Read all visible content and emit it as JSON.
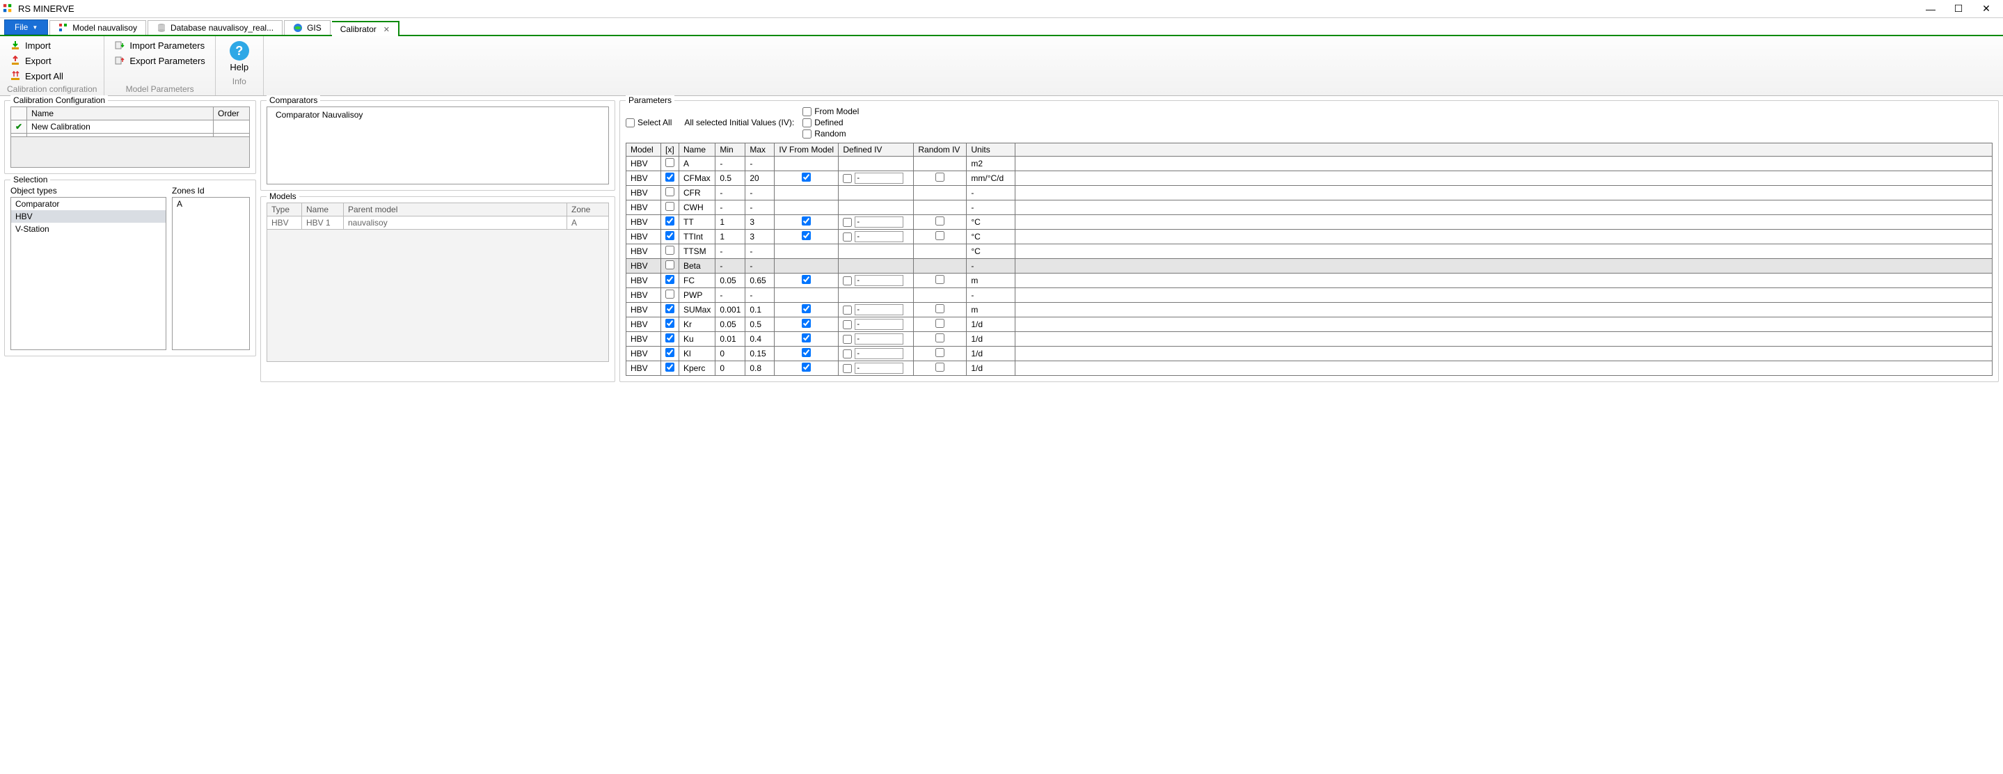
{
  "window": {
    "title": "RS MINERVE"
  },
  "tabs": {
    "file": "File",
    "items": [
      {
        "label": "Model nauvalisoy"
      },
      {
        "label": "Database nauvalisoy_real..."
      },
      {
        "label": "GIS"
      },
      {
        "label": "Calibrator"
      }
    ]
  },
  "ribbon": {
    "g1": {
      "import": "Import",
      "export": "Export",
      "export_all": "Export All",
      "label": "Calibration configuration"
    },
    "g2": {
      "import_params": "Import Parameters",
      "export_params": "Export Parameters",
      "label": "Model Parameters"
    },
    "g3": {
      "help": "Help",
      "label": "Info"
    }
  },
  "cal_conf": {
    "legend": "Calibration Configuration",
    "headers": {
      "name": "Name",
      "order": "Order"
    },
    "rows": [
      {
        "name": "New Calibration",
        "order": ""
      }
    ]
  },
  "selection": {
    "legend": "Selection",
    "obj_types_label": "Object types",
    "zones_label": "Zones Id",
    "obj_types": [
      "Comparator",
      "HBV",
      "V-Station"
    ],
    "zones": [
      "A"
    ]
  },
  "comparators": {
    "legend": "Comparators",
    "items": [
      "Comparator Nauvalisoy"
    ]
  },
  "models": {
    "legend": "Models",
    "headers": {
      "type": "Type",
      "name": "Name",
      "parent": "Parent model",
      "zone": "Zone"
    },
    "rows": [
      {
        "type": "HBV",
        "name": "HBV 1",
        "parent": "nauvalisoy",
        "zone": "A"
      }
    ]
  },
  "params": {
    "legend": "Parameters",
    "select_all": "Select All",
    "iv_label": "All selected Initial Values (IV):",
    "iv_opts": {
      "from_model": "From Model",
      "defined": "Defined",
      "random": "Random"
    },
    "headers": {
      "model": "Model",
      "x": "[x]",
      "name": "Name",
      "min": "Min",
      "max": "Max",
      "ivm": "IV From Model",
      "div": "Defined IV",
      "riv": "Random IV",
      "units": "Units"
    },
    "rows": [
      {
        "model": "HBV",
        "x": false,
        "name": "A",
        "min": "-",
        "max": "-",
        "ivm": null,
        "div": null,
        "riv": null,
        "units": "m2"
      },
      {
        "model": "HBV",
        "x": true,
        "name": "CFMax",
        "min": "0.5",
        "max": "20",
        "ivm": true,
        "div": {
          "checked": false,
          "value": "-"
        },
        "riv": false,
        "units": "mm/°C/d"
      },
      {
        "model": "HBV",
        "x": false,
        "name": "CFR",
        "min": "-",
        "max": "-",
        "ivm": null,
        "div": null,
        "riv": null,
        "units": "-"
      },
      {
        "model": "HBV",
        "x": false,
        "name": "CWH",
        "min": "-",
        "max": "-",
        "ivm": null,
        "div": null,
        "riv": null,
        "units": "-"
      },
      {
        "model": "HBV",
        "x": true,
        "name": "TT",
        "min": "1",
        "max": "3",
        "ivm": true,
        "div": {
          "checked": false,
          "value": "-"
        },
        "riv": false,
        "units": "°C"
      },
      {
        "model": "HBV",
        "x": true,
        "name": "TTInt",
        "min": "1",
        "max": "3",
        "ivm": true,
        "div": {
          "checked": false,
          "value": "-"
        },
        "riv": false,
        "units": "°C"
      },
      {
        "model": "HBV",
        "x": false,
        "name": "TTSM",
        "min": "-",
        "max": "-",
        "ivm": null,
        "div": null,
        "riv": null,
        "units": "°C"
      },
      {
        "model": "HBV",
        "x": false,
        "name": "Beta",
        "min": "-",
        "max": "-",
        "ivm": null,
        "div": null,
        "riv": null,
        "units": "-",
        "hi": true
      },
      {
        "model": "HBV",
        "x": true,
        "name": "FC",
        "min": "0.05",
        "max": "0.65",
        "ivm": true,
        "div": {
          "checked": false,
          "value": "-"
        },
        "riv": false,
        "units": "m"
      },
      {
        "model": "HBV",
        "x": false,
        "name": "PWP",
        "min": "-",
        "max": "-",
        "ivm": null,
        "div": null,
        "riv": null,
        "units": "-"
      },
      {
        "model": "HBV",
        "x": true,
        "name": "SUMax",
        "min": "0.001",
        "max": "0.1",
        "ivm": true,
        "div": {
          "checked": false,
          "value": "-"
        },
        "riv": false,
        "units": "m"
      },
      {
        "model": "HBV",
        "x": true,
        "name": "Kr",
        "min": "0.05",
        "max": "0.5",
        "ivm": true,
        "div": {
          "checked": false,
          "value": "-"
        },
        "riv": false,
        "units": "1/d"
      },
      {
        "model": "HBV",
        "x": true,
        "name": "Ku",
        "min": "0.01",
        "max": "0.4",
        "ivm": true,
        "div": {
          "checked": false,
          "value": "-"
        },
        "riv": false,
        "units": "1/d"
      },
      {
        "model": "HBV",
        "x": true,
        "name": "Kl",
        "min": "0",
        "max": "0.15",
        "ivm": true,
        "div": {
          "checked": false,
          "value": "-"
        },
        "riv": false,
        "units": "1/d"
      },
      {
        "model": "HBV",
        "x": true,
        "name": "Kperc",
        "min": "0",
        "max": "0.8",
        "ivm": true,
        "div": {
          "checked": false,
          "value": "-"
        },
        "riv": false,
        "units": "1/d"
      }
    ]
  }
}
